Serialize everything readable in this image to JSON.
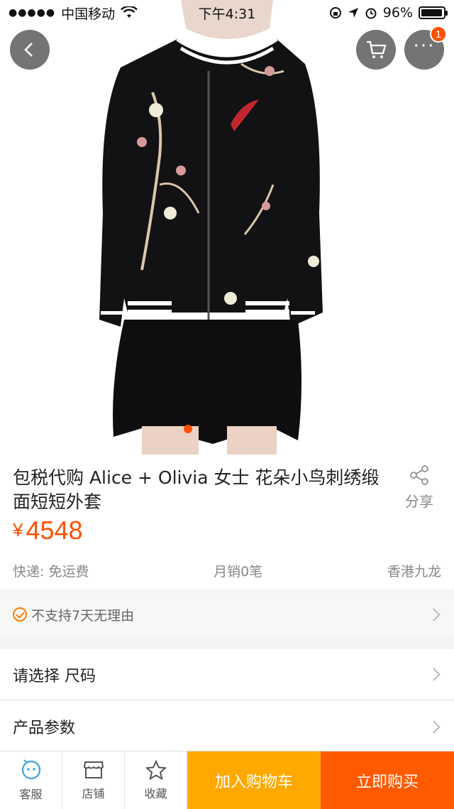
{
  "status_bar": {
    "carrier": "中国移动",
    "signal": "●●●●●",
    "time": "下午4:31",
    "battery_percent": "96%",
    "battery_level": 0.96
  },
  "header": {
    "cart_badge": "1",
    "more_label": "···"
  },
  "product": {
    "title": "包税代购 Alice + Olivia 女士  花朵小鸟刺绣缎面短短外套",
    "share_label": "分享",
    "currency": "¥",
    "price": "4548",
    "shipping": "快递: 免运费",
    "monthly_sales": "月销0笔",
    "location": "香港九龙"
  },
  "service": {
    "notice": "不支持7天无理由"
  },
  "options": {
    "select_size": "请选择 尺码",
    "params": "产品参数"
  },
  "bottom_bar": {
    "tabs": [
      {
        "label": "客服",
        "icon": "chat-face-icon"
      },
      {
        "label": "店铺",
        "icon": "shop-icon"
      },
      {
        "label": "收藏",
        "icon": "star-icon"
      }
    ],
    "add_to_cart": "加入购物车",
    "buy_now": "立即购买"
  },
  "colors": {
    "accent": "#ff5000",
    "cart_button": "#ffa800",
    "buy_button": "#ff5a00"
  },
  "carousel": {
    "active_index": 0
  }
}
